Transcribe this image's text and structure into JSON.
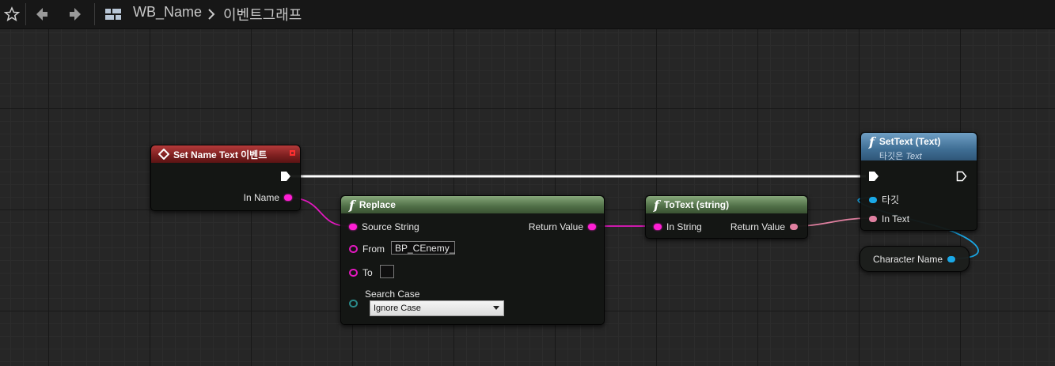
{
  "breadcrumb": {
    "blueprint": "WB_Name",
    "graph": "이벤트그래프"
  },
  "nodes": {
    "event": {
      "title": "Set Name Text 이벤트",
      "out_pin": "In Name"
    },
    "replace": {
      "title": "Replace",
      "source_string": "Source String",
      "return_value": "Return Value",
      "from_label": "From",
      "from_value": "BP_CEnemy_",
      "to_label": "To",
      "to_value": "",
      "search_case_label": "Search Case",
      "search_case_value": "Ignore Case"
    },
    "totext": {
      "title": "ToText (string)",
      "in_pin": "In String",
      "return_value": "Return Value"
    },
    "settext": {
      "title": "SetText (Text)",
      "subtitle_prefix": "타깃은",
      "subtitle_target": "Text",
      "target_pin": "타깃",
      "in_text": "In Text"
    },
    "variable": {
      "label": "Character Name"
    }
  },
  "colors": {
    "exec_wire": "#ffffff",
    "string_pin": "#ff1fd4",
    "text_pin": "#e080a0",
    "object_pin": "#1aa8e6",
    "event_header": "#7c1f1f",
    "function_header": "#4f6e46",
    "target_function_header": "#3f6e94"
  },
  "icons": {
    "favorite": "star-icon",
    "back": "arrow-left-icon",
    "forward": "arrow-right-icon",
    "graph": "blueprint-graph-icon",
    "event": "event-diamond-icon",
    "function": "function-f-icon"
  }
}
